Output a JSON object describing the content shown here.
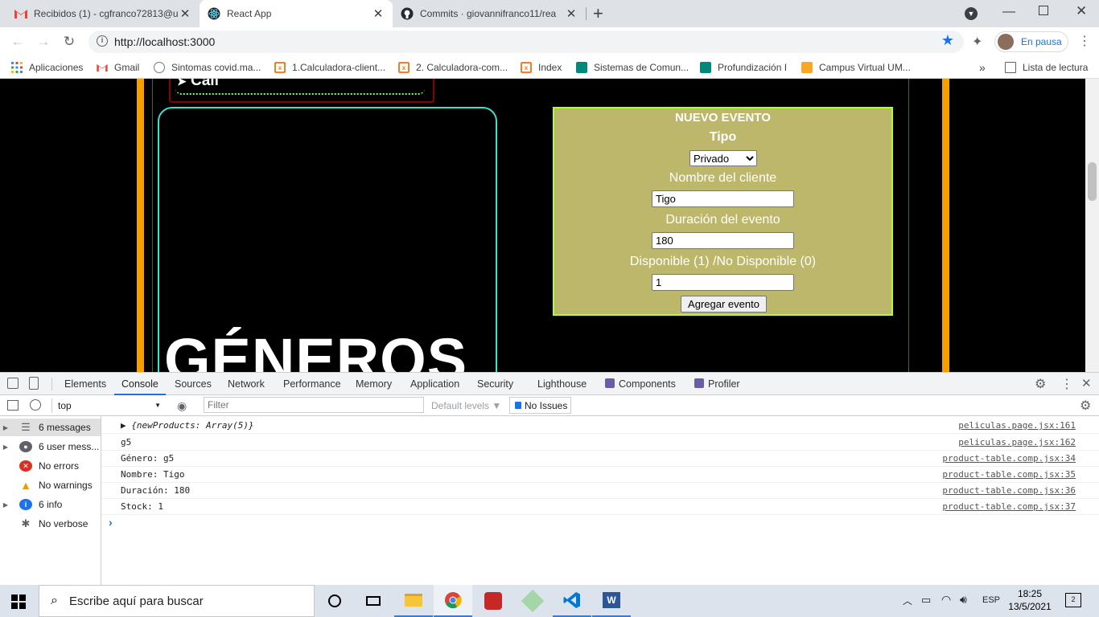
{
  "browser": {
    "tabs": [
      {
        "title": "Recibidos (1) - cgfranco72813@u",
        "icon": "gmail-icon",
        "active": false
      },
      {
        "title": "React App",
        "icon": "react-icon",
        "active": true
      },
      {
        "title": "Commits · giovannifranco11/rea",
        "icon": "github-icon",
        "active": false
      }
    ],
    "new_tab": "+",
    "close": "✕",
    "url": "http://localhost:3000",
    "profile_label": "En pausa",
    "bookmarks": [
      {
        "label": "Aplicaciones",
        "icon": "apps-grid-icon"
      },
      {
        "label": "Gmail",
        "icon": "gmail-icon"
      },
      {
        "label": "Sintomas covid.ma...",
        "icon": "bookmark-site-icon"
      },
      {
        "label": "1.Calculadora-client...",
        "icon": "xampp-icon"
      },
      {
        "label": "2. Calculadora-com...",
        "icon": "xampp-icon"
      },
      {
        "label": "Index",
        "icon": "xampp-icon"
      },
      {
        "label": "Sistemas de Comun...",
        "icon": "meet-icon"
      },
      {
        "label": "Profundización I",
        "icon": "meet-icon"
      },
      {
        "label": "Campus Virtual UM...",
        "icon": "moodle-icon"
      }
    ],
    "reading_list": "Lista de lectura"
  },
  "page": {
    "call_text": "Call",
    "generos_title": "GÉNEROS",
    "form": {
      "title": "NUEVO EVENTO",
      "tipo_label": "Tipo",
      "tipo_value": "Privado",
      "cliente_label": "Nombre del cliente",
      "cliente_value": "Tigo",
      "duracion_label": "Duración del evento",
      "duracion_value": "180",
      "disponible_label": "Disponible (1) /No Disponible (0)",
      "disponible_value": "1",
      "submit_label": "Agregar evento"
    }
  },
  "devtools": {
    "tabs": [
      "Elements",
      "Console",
      "Sources",
      "Network",
      "Performance",
      "Memory",
      "Application",
      "Security",
      "Lighthouse",
      "Components",
      "Profiler"
    ],
    "active_tab": "Console",
    "context": "top",
    "filter_placeholder": "Filter",
    "levels": "Default levels ▼",
    "issues": "No Issues",
    "sidebar": [
      {
        "label": "6 messages",
        "icon": "list-icon",
        "expandable": true
      },
      {
        "label": "6 user mess...",
        "icon": "user-icon",
        "expandable": true
      },
      {
        "label": "No errors",
        "icon": "error-icon",
        "expandable": false
      },
      {
        "label": "No warnings",
        "icon": "warning-icon",
        "expandable": false
      },
      {
        "label": "6 info",
        "icon": "info-icon",
        "expandable": true
      },
      {
        "label": "No verbose",
        "icon": "bug-icon",
        "expandable": false
      }
    ],
    "console_rows": [
      {
        "message": "▶ {newProducts: Array(5)}",
        "source": "peliculas.page.jsx:161"
      },
      {
        "message": "g5",
        "source": "peliculas.page.jsx:162"
      },
      {
        "message": "Género: g5",
        "source": "product-table.comp.jsx:34"
      },
      {
        "message": "Nombre: Tigo",
        "source": "product-table.comp.jsx:35"
      },
      {
        "message": "Duración: 180",
        "source": "product-table.comp.jsx:36"
      },
      {
        "message": "Stock: 1",
        "source": "product-table.comp.jsx:37"
      }
    ],
    "prompt": "›"
  },
  "taskbar": {
    "search_placeholder": "Escribe aquí para buscar",
    "language": "ESP",
    "time": "18:25",
    "date": "13/5/2021",
    "notification_count": "2"
  },
  "colors": {
    "form_bg": "#bdb76b",
    "form_border": "#adff2f",
    "card_border": "#40e0d0",
    "side_bars": "#f59f00",
    "accent": "#1a73e8"
  }
}
